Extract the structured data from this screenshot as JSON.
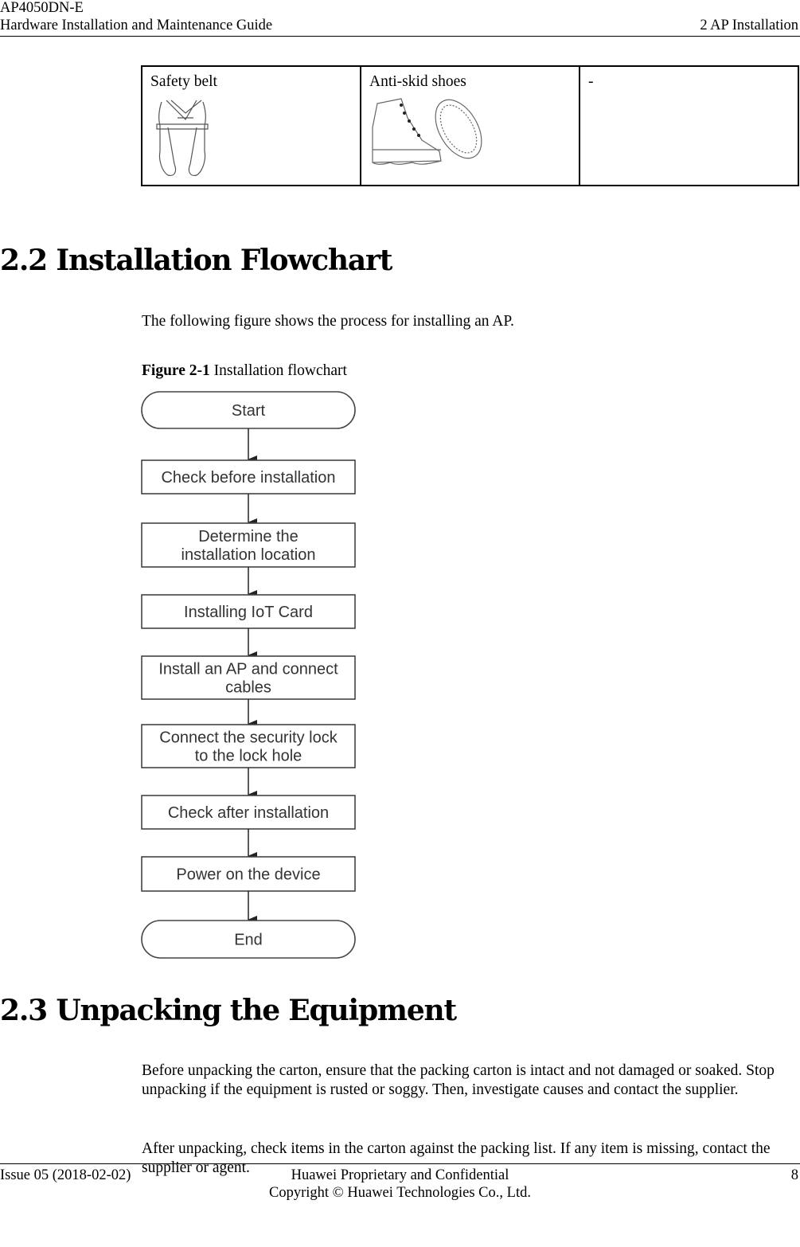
{
  "header": {
    "product": "AP4050DN-E",
    "guide_title": "Hardware Installation and Maintenance Guide",
    "chapter": "2 AP Installation"
  },
  "tools_table": {
    "cells": [
      {
        "label": "Safety belt",
        "icon": "safety-belt-illustration"
      },
      {
        "label": "Anti-skid shoes",
        "icon": "anti-skid-shoes-illustration"
      },
      {
        "label": "-",
        "icon": null
      }
    ]
  },
  "section_2_2": {
    "heading": "2.2 Installation Flowchart",
    "intro": "The following figure shows the process for installing an AP.",
    "figure_label": "Figure 2-1",
    "figure_caption": " Installation flowchart"
  },
  "flowchart": {
    "nodes": [
      {
        "type": "terminal",
        "lines": [
          "Start"
        ]
      },
      {
        "type": "process",
        "lines": [
          "Check before installation"
        ]
      },
      {
        "type": "process",
        "lines": [
          "Determine the",
          "installation location"
        ]
      },
      {
        "type": "process",
        "lines": [
          "Installing IoT Card"
        ]
      },
      {
        "type": "process",
        "lines": [
          "Install an AP and connect",
          "cables"
        ]
      },
      {
        "type": "process",
        "lines": [
          "Connect the security lock",
          "to the lock hole"
        ]
      },
      {
        "type": "process",
        "lines": [
          "Check after installation"
        ]
      },
      {
        "type": "process",
        "lines": [
          "Power on the device"
        ]
      },
      {
        "type": "terminal",
        "lines": [
          "End"
        ]
      }
    ]
  },
  "section_2_3": {
    "heading": "2.3 Unpacking the Equipment",
    "paragraphs": [
      "Before unpacking the carton, ensure that the packing carton is intact and not damaged or soaked. Stop unpacking if the equipment is rusted or soggy. Then, investigate causes and contact the supplier.",
      "After unpacking, check items in the carton against the packing list. If any item is missing, contact the supplier or agent."
    ]
  },
  "footer": {
    "issue": "Issue 05 (2018-02-02)",
    "confidential": "Huawei Proprietary and Confidential",
    "copyright": "Copyright © Huawei Technologies Co., Ltd.",
    "page_number": "8"
  }
}
